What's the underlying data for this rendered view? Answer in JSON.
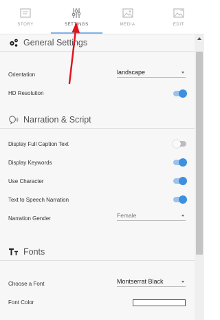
{
  "tabs": [
    {
      "label": "STORY",
      "icon": "story-icon",
      "active": false
    },
    {
      "label": "SETTINGS",
      "icon": "sliders-icon",
      "active": true
    },
    {
      "label": "MEDIA",
      "icon": "image-icon",
      "active": false
    },
    {
      "label": "EDIT",
      "icon": "edit-image-icon",
      "active": false
    }
  ],
  "general": {
    "title": "General Settings",
    "orientation_label": "Orientation",
    "orientation_value": "landscape",
    "hd_label": "HD Resolution",
    "hd_on": true
  },
  "narration": {
    "title": "Narration & Script",
    "caption_label": "Display Full Caption Text",
    "caption_on": false,
    "keywords_label": "Display Keywords",
    "keywords_on": true,
    "character_label": "Use Character",
    "character_on": true,
    "tts_label": "Text to Speech Narration",
    "tts_on": true,
    "gender_label": "Narration Gender",
    "gender_value": "Female"
  },
  "fonts": {
    "title": "Fonts",
    "font_label": "Choose a Font",
    "font_value": "Montserrat Black",
    "color_label": "Font Color"
  },
  "colors": {
    "accent": "#3d8fe0",
    "annotation_arrow": "#e0141e"
  }
}
